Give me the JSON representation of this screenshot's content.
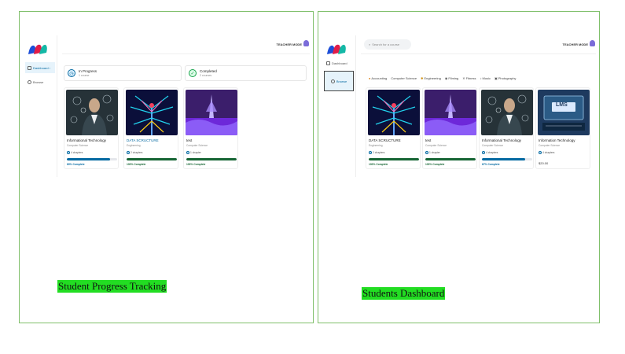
{
  "left_panel": {
    "caption": "Student Progress Tracking",
    "teacher_mode": "TEACHER MODE",
    "nav": [
      {
        "label": "Dashboard ›",
        "icon": "dashboard-icon"
      },
      {
        "label": "Browse",
        "icon": "compass-icon"
      }
    ],
    "stats": [
      {
        "title": "In Progress",
        "sub": "1 course",
        "color": "#0369a1",
        "icon": "clock-icon"
      },
      {
        "title": "Completed",
        "sub": "2 courses",
        "color": "#16a34a",
        "icon": "check-circle-icon"
      }
    ],
    "courses": [
      {
        "title": "Informational Technology",
        "category": "Computer Science",
        "chapters": "4 chapters",
        "progress_text": "80% Complete",
        "progress": 0.86,
        "bar_color": "#0369a1",
        "thumb": "tech-man",
        "title_color": "default"
      },
      {
        "title": "DATA SCRUCTURE",
        "category": "Engineering",
        "chapters": "2 chapters",
        "progress_text": "100% Complete",
        "progress": 1.0,
        "bar_color": "#166534",
        "thumb": "neon-tree",
        "title_color": "blue"
      },
      {
        "title": "test",
        "category": "Computer Science",
        "chapters": "1 chapter",
        "progress_text": "100% Complete",
        "progress": 1.0,
        "bar_color": "#166534",
        "thumb": "purple-wave",
        "title_color": "default"
      }
    ]
  },
  "right_panel": {
    "caption": "Students Dashboard",
    "teacher_mode": "TEACHER MODE",
    "search_placeholder": "Search for a course",
    "nav": [
      {
        "label": "Dashboard",
        "icon": "dashboard-icon"
      },
      {
        "label": "Browse",
        "icon": "compass-icon"
      }
    ],
    "categories": [
      {
        "label": "Accounting",
        "icon": "coins-icon"
      },
      {
        "label": "Computer Science",
        "icon": ""
      },
      {
        "label": "Engineering",
        "icon": "cog-icon"
      },
      {
        "label": "Filming",
        "icon": "camera-icon"
      },
      {
        "label": "Fitness",
        "icon": "dumbbell-icon"
      },
      {
        "label": "Music",
        "icon": "music-icon"
      },
      {
        "label": "Photography",
        "icon": "photo-icon"
      }
    ],
    "courses": [
      {
        "title": "DATA SCRUCTURE",
        "category": "Engineering",
        "chapters": "2 chapters",
        "progress_text": "100% Complete",
        "progress": 1.0,
        "bar_color": "#166534",
        "thumb": "neon-tree"
      },
      {
        "title": "test",
        "category": "Computer Science",
        "chapters": "1 chapter",
        "progress_text": "100% Complete",
        "progress": 1.0,
        "bar_color": "#166534",
        "thumb": "purple-wave"
      },
      {
        "title": "Informational Technology",
        "category": "Computer Science",
        "chapters": "4 chapters",
        "progress_text": "67% Complete",
        "progress": 0.86,
        "bar_color": "#0369a1",
        "thumb": "tech-man"
      },
      {
        "title": "Information Technology",
        "category": "Computer Science",
        "chapters": "4 chapters",
        "price": "$20.00",
        "thumb": "lms-screen"
      }
    ]
  }
}
